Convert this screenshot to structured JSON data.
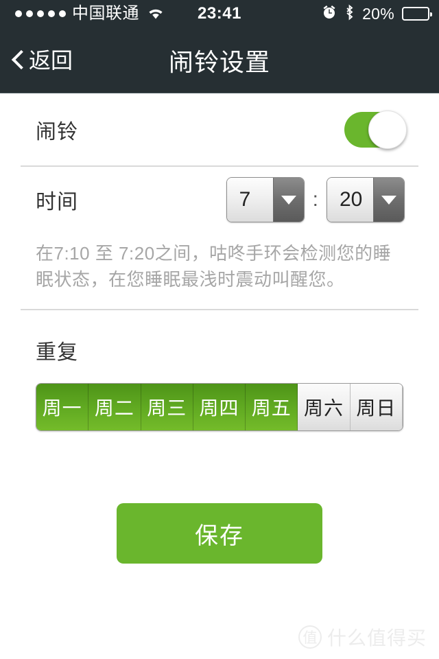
{
  "status_bar": {
    "signal_dots": 5,
    "carrier": "中国联通",
    "wifi_icon": "wifi-icon",
    "time": "23:41",
    "alarm_icon": "alarm-clock-icon",
    "bluetooth_icon": "bluetooth-icon",
    "battery_percent": "20%",
    "battery_level": 20,
    "battery_color": "#f03030"
  },
  "nav_bar": {
    "back_label": "返回",
    "back_icon": "chevron-left-icon",
    "title": "闹铃设置",
    "background": "#262f33"
  },
  "alarm": {
    "label": "闹铃",
    "enabled": true,
    "toggle_color": "#6ab62d"
  },
  "time_setting": {
    "label": "时间",
    "hour": "7",
    "minute": "20",
    "separator": ":",
    "dropdown_icon": "chevron-down-icon",
    "description": "在7:10 至 7:20之间，咕咚手环会检测您的睡眠状态，在您睡眠最浅时震动叫醒您。"
  },
  "repeat": {
    "title": "重复",
    "days": [
      {
        "label": "周一",
        "selected": true
      },
      {
        "label": "周二",
        "selected": true
      },
      {
        "label": "周三",
        "selected": true
      },
      {
        "label": "周四",
        "selected": true
      },
      {
        "label": "周五",
        "selected": true
      },
      {
        "label": "周六",
        "selected": false
      },
      {
        "label": "周日",
        "selected": false
      }
    ],
    "selected_color": "#62ab22"
  },
  "save": {
    "label": "保存",
    "color": "#6ab62d"
  },
  "watermark": {
    "logo_char": "值",
    "text": "什么值得买"
  }
}
